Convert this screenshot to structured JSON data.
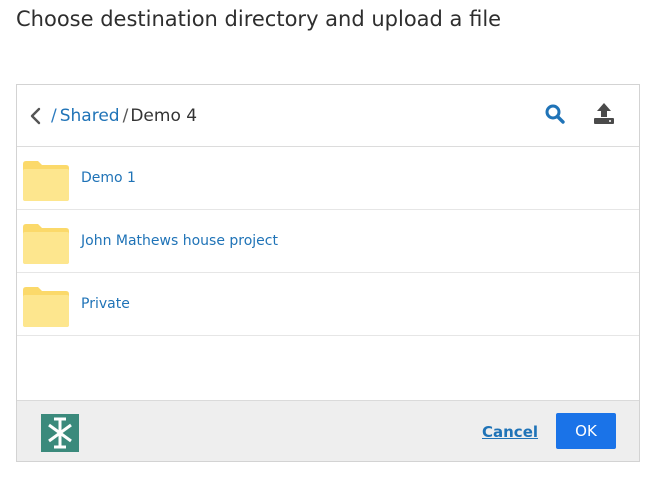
{
  "dialog": {
    "title": "Choose destination directory and upload a file"
  },
  "nav": {
    "breadcrumb": {
      "root_sep": "/",
      "parent": "Shared",
      "sep": "/",
      "current": "Demo 4"
    },
    "icons": {
      "back": "chevron-left-icon",
      "search": "search-icon",
      "upload": "upload-icon"
    }
  },
  "list": {
    "items": [
      {
        "label": "Demo 1",
        "icon": "folder-icon"
      },
      {
        "label": "John Mathews house project",
        "icon": "folder-icon"
      },
      {
        "label": "Private",
        "icon": "folder-icon"
      }
    ]
  },
  "footer": {
    "cancel_label": "Cancel",
    "ok_label": "OK"
  },
  "colors": {
    "link": "#1f73b7",
    "primary_button": "#1a73e8",
    "folder": "#fde48a",
    "logo": "#3b8a7c",
    "footer_bg": "#eeeeee"
  }
}
